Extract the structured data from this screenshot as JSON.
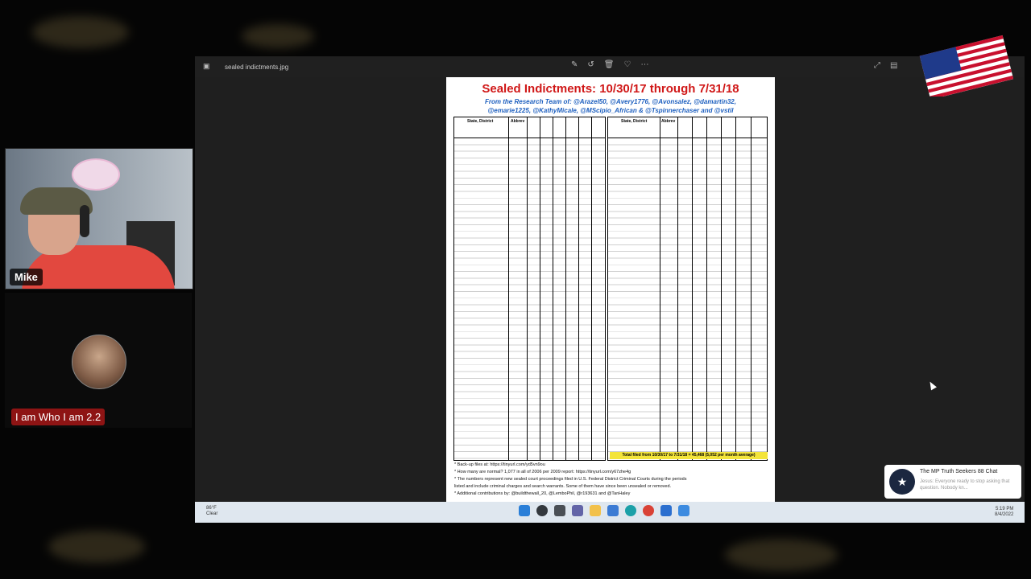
{
  "stream": {
    "host_name": "Mike",
    "guest_name": "I am Who I am 2.2"
  },
  "viewer": {
    "file_name": "sealed indictments.jpg"
  },
  "document": {
    "title": "Sealed Indictments: 10/30/17 through 7/31/18",
    "subtitle_line1": "From the Research Team of: @Arazel50, @Avery1776, @Avonsalez, @damartin32,",
    "subtitle_line2": "@emarie1225, @KathyMicale, @MScipio_African & @Tspinnerchaser and @vstil",
    "left_header": {
      "col1": "State, District",
      "col2": "Abbrev"
    },
    "right_header": {
      "col1": "State, District",
      "col2": "Abbrev"
    },
    "total_label": "Total",
    "total_bar": "Total filed from 10/30/17 to 7/31/18 = 45,468 (5,052 per month average)",
    "footnotes": [
      "* Back-up files at: https://tinyurl.com/yd5vn9ou",
      "* How many are normal? 1,077 in all of 2006 per 2009 report: https://tinyurl.com/y67zhe4g",
      "* The numbers represent new sealed court proceedings filed in U.S. Federal District Criminal Courts during the periods",
      "  listed and include criminal charges and search warrants. Some of them have since been unsealed or removed.",
      "* Additional contributions by: @buildthewall_20, @LemboPhil, @r193631 and @TanHaley"
    ],
    "source": "* Source: PACER.gov"
  },
  "taskbar": {
    "weather_temp": "86°F",
    "weather_desc": "Clear",
    "time": "5:19 PM",
    "date": "8/4/2022"
  },
  "toast": {
    "title": "The MP Truth Seekers 88 Chat",
    "message": "Jesus: Everyone ready to stop asking that question. Nobody kn..."
  }
}
